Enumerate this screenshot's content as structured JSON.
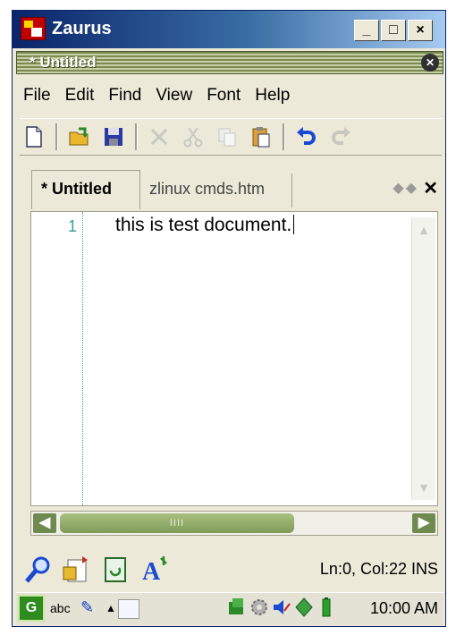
{
  "window": {
    "title": "Zaurus"
  },
  "document": {
    "title": "* Untitled"
  },
  "menu": [
    "File",
    "Edit",
    "Find",
    "View",
    "Font",
    "Help"
  ],
  "toolbar": [
    "new-document-icon",
    "open-folder-icon",
    "save-icon",
    "delete-icon",
    "cut-icon",
    "copy-icon",
    "paste-icon",
    "undo-icon",
    "redo-icon"
  ],
  "tabs": [
    {
      "label": "* Untitled",
      "active": true
    },
    {
      "label": "zlinux cmds.htm",
      "active": false
    }
  ],
  "editor": {
    "line_number": "1",
    "text": "this is test document."
  },
  "hscroll": {
    "grip": "IIII"
  },
  "status": {
    "position": "Ln:0, Col:22 INS"
  },
  "taskbar": {
    "input_label": "abc",
    "clock": "10:00 AM"
  },
  "colors": {
    "title_blue": "#0a246a",
    "scroll_green": "#6f8a50",
    "line_number": "#3c9a9a"
  }
}
